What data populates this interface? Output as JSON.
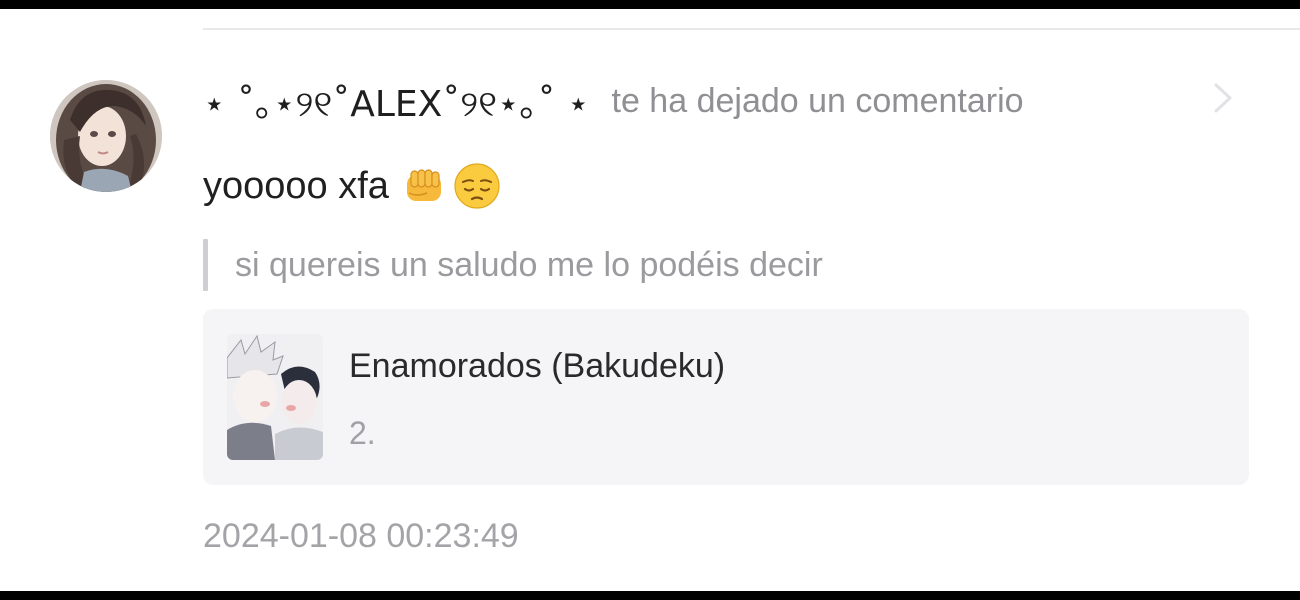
{
  "notification": {
    "username": "⋆ ˚｡⋆୨୧˚ALEX˚୨୧⋆｡˚ ⋆",
    "action_text": "te ha dejado un comentario",
    "avatar_icon": "user-avatar",
    "chevron_icon": "chevron-right-icon"
  },
  "comment": {
    "text": "yooooo xfa",
    "emojis": [
      "fist-bump-emoji",
      "pensive-face-emoji"
    ]
  },
  "quote": {
    "text": "si quereis un saludo me lo podéis decir"
  },
  "story_card": {
    "title": "Enamorados (Bakudeku)",
    "chapter": "2.",
    "cover_icon": "story-cover-image"
  },
  "timestamp": "2024-01-08 00:23:49",
  "colors": {
    "background": "#ffffff",
    "frame": "#000000",
    "card_background": "#f5f5f7",
    "primary_text": "#1f1f1f",
    "secondary_text": "#8f8f94",
    "quote_bar": "#cfcfd3"
  }
}
